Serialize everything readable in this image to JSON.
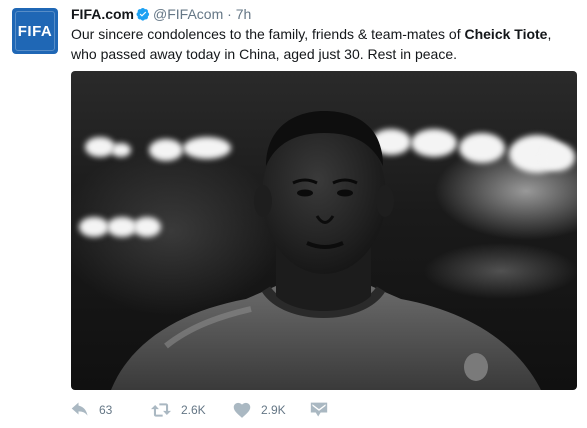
{
  "tweet": {
    "avatar_text": "FIFA",
    "display_name": "FIFA.com",
    "handle": "@FIFAcom",
    "separator": "·",
    "time": "7h",
    "text_before": "Our sincere condolences to the family, friends & team-mates of ",
    "text_bold": "Cheick Tiote",
    "text_after": ", who passed away today in China, aged just 30. Rest in peace."
  },
  "actions": {
    "reply_count": "63",
    "retweet_count": "2.6K",
    "like_count": "2.9K"
  },
  "colors": {
    "avatar_bg": "#1f67b5",
    "verified_badge": "#1da1f2",
    "meta_text": "#657786",
    "action_icon": "#aab8c2"
  },
  "icons": {
    "verified": "verified-badge-icon",
    "reply": "reply-icon",
    "retweet": "retweet-icon",
    "like": "heart-icon",
    "message": "direct-message-icon"
  }
}
